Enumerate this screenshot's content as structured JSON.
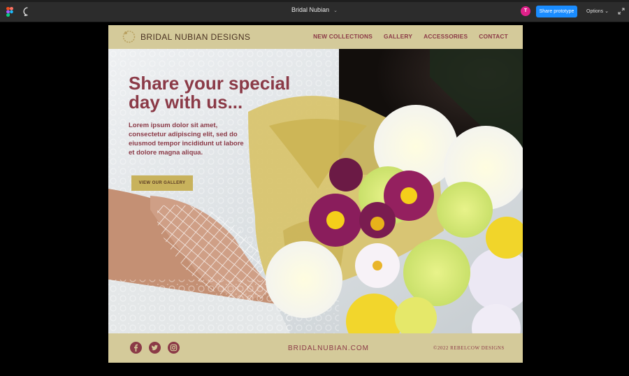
{
  "app": {
    "document_title": "Bridal Nubian",
    "share_label": "Share prototype",
    "options_label": "Options",
    "avatar_initial": "T",
    "accent": "#1a8cff"
  },
  "site": {
    "brand": "BRIDAL NUBIAN DESIGNS",
    "nav": [
      "NEW COLLECTIONS",
      "GALLERY",
      "ACCESSORIES",
      "CONTACT"
    ],
    "headline": "Share your special day with us...",
    "body": "Lorem ipsum dolor sit amet, consectetur adipiscing elit, sed do eiusmod tempor incididunt ut labore et dolore magna aliqua.",
    "cta": "VIEW OUR GALLERY",
    "footer": {
      "url": "BRIDALNUBIAN.COM",
      "copyright": "©2022 REBELCOW DESIGNS",
      "social": [
        "facebook-icon",
        "twitter-icon",
        "instagram-icon"
      ]
    },
    "colors": {
      "primary": "#8b3a47",
      "band": "#d4ca9a",
      "button": "#c8b25c"
    }
  }
}
